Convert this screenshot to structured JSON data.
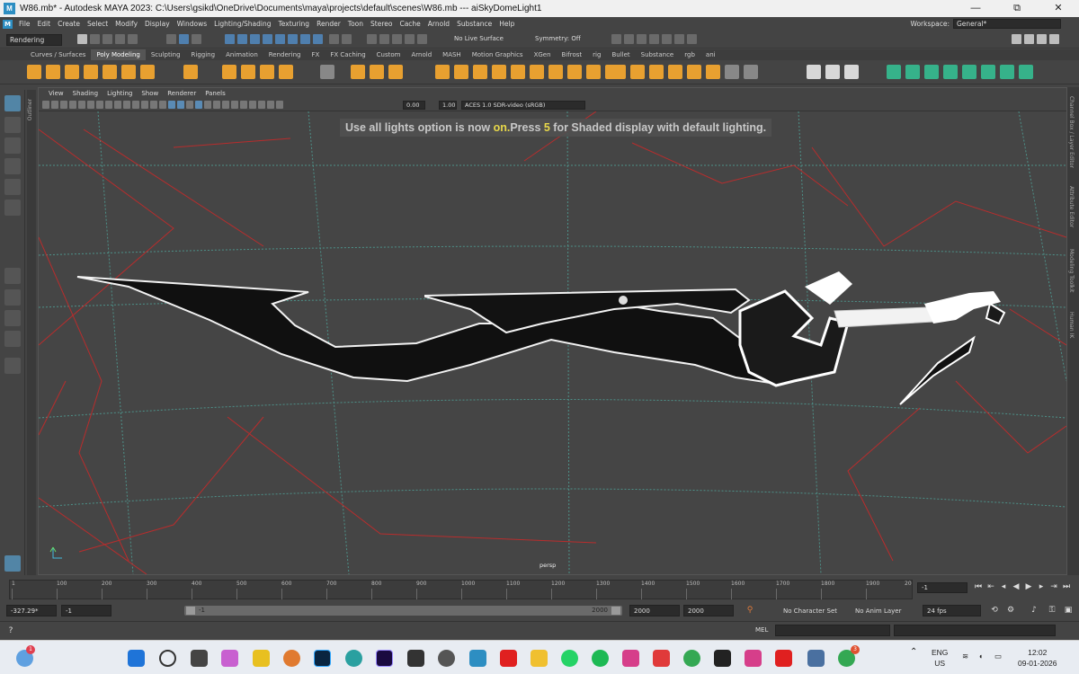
{
  "window": {
    "title": "W86.mb* - Autodesk MAYA 2023: C:\\Users\\gsikd\\OneDrive\\Documents\\maya\\projects\\default\\scenes\\W86.mb  ---  aiSkyDomeLight1",
    "logo": "M",
    "minimize": "—",
    "maximize": "⧉",
    "close": "✕"
  },
  "menubar": {
    "items": [
      "File",
      "Edit",
      "Create",
      "Select",
      "Modify",
      "Display",
      "Windows",
      "Lighting/Shading",
      "Texturing",
      "Render",
      "Toon",
      "Stereo",
      "Cache",
      "Arnold",
      "Substance",
      "Help"
    ],
    "workspace_label": "Workspace:",
    "workspace_value": "General*"
  },
  "statusline": {
    "menuset": "Rendering",
    "live_surface": "No Live Surface",
    "symmetry": "Symmetry: Off"
  },
  "shelf": {
    "tabs": [
      "Curves / Surfaces",
      "Poly Modeling",
      "Sculpting",
      "Rigging",
      "Animation",
      "Rendering",
      "FX",
      "FX Caching",
      "Custom",
      "Arnold",
      "MASH",
      "Motion Graphics",
      "XGen",
      "Bifrost",
      "rig",
      "Bullet",
      "Substance",
      "rgb",
      "ani"
    ],
    "active_tab": "Poly Modeling"
  },
  "panel": {
    "menus": [
      "View",
      "Shading",
      "Lighting",
      "Show",
      "Renderer",
      "Panels"
    ],
    "exposure": "0.00",
    "gamma": "1.00",
    "colorspace": "ACES 1.0 SDR-video (sRGB)"
  },
  "viewport": {
    "hud_prefix": "Use all lights option is now ",
    "hud_on": "on.",
    "hud_mid": "Press ",
    "hud_key": "5",
    "hud_suffix": " for Shaded display with default lighting.",
    "camera": "persp",
    "outliner_tab": "Outliner",
    "right_tabs": [
      "Channel Box / Layer Editor",
      "Attribute Editor",
      "Modeling Toolkit",
      "Human IK"
    ]
  },
  "timeslider": {
    "ticks": [
      "1",
      "100",
      "200",
      "300",
      "400",
      "500",
      "600",
      "700",
      "800",
      "900",
      "1000",
      "1100",
      "1200",
      "1300",
      "1400",
      "1500",
      "1600",
      "1700",
      "1800",
      "1900",
      "20"
    ],
    "current_frame": "-1"
  },
  "range": {
    "field1": "-327.29*",
    "field2": "-1",
    "slider_start": "-1",
    "slider_end": "2000",
    "end1": "2000",
    "end2": "2000",
    "character_set": "No Character Set",
    "anim_layer": "No Anim Layer",
    "fps": "24 fps"
  },
  "cmdline": {
    "lang": "MEL"
  },
  "taskbar": {
    "lang_top": "ENG",
    "lang_bottom": "US",
    "time": "12:02",
    "date": "09-01-2026",
    "notification_count": "1",
    "chrome_badge": "3"
  }
}
